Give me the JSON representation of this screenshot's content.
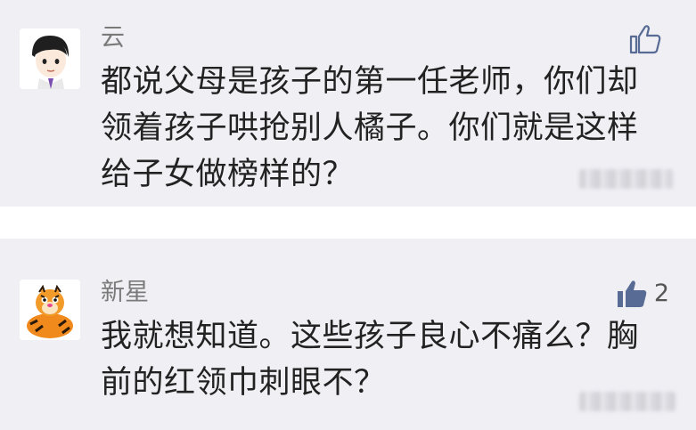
{
  "comments": [
    {
      "username": "云",
      "text": "都说父母是孩子的第一任老师，你们却\n领着孩子哄抢别人橘子。你们就是这样\n给子女做榜样的？",
      "like": {
        "icon": "thumbs-up-outline-icon",
        "count": ""
      },
      "avatar": "cartoon-boy-avatar"
    },
    {
      "username": "新星",
      "text": "我就想知道。这些孩子良心不痛么？胸\n前的红领巾刺眼不？",
      "like": {
        "icon": "thumbs-up-filled-icon",
        "count": "2",
        "color": "#576b95"
      },
      "avatar": "tigger-avatar"
    }
  ]
}
